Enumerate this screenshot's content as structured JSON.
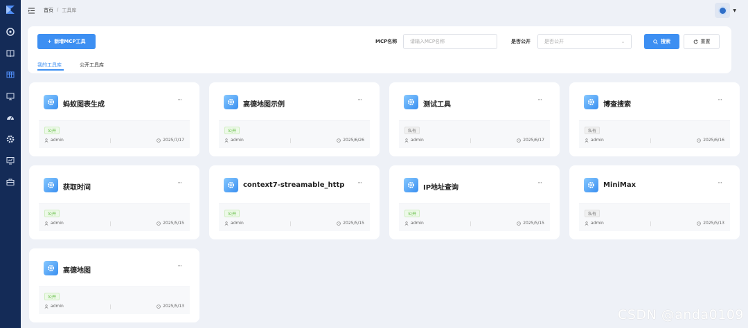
{
  "breadcrumb": {
    "home": "首页",
    "separator": "/",
    "current": "工具库"
  },
  "toolbar": {
    "new_button": "新增MCP工具",
    "name_label": "MCP名称",
    "name_placeholder": "请输入MCP名称",
    "public_label": "是否公开",
    "public_placeholder": "是否公开",
    "search_button": "搜索",
    "reset_button": "重置"
  },
  "tabs": [
    {
      "label": "我的工具库",
      "active": true
    },
    {
      "label": "公开工具库",
      "active": false
    }
  ],
  "cards": [
    {
      "title": "蚂蚁图表生成",
      "visibility": "公开",
      "owner": "admin",
      "date": "2025/7/17"
    },
    {
      "title": "高德地图示例",
      "visibility": "公开",
      "owner": "admin",
      "date": "2025/6/26"
    },
    {
      "title": "测试工具",
      "visibility": "私有",
      "owner": "admin",
      "date": "2025/6/17"
    },
    {
      "title": "博查搜索",
      "visibility": "私有",
      "owner": "admin",
      "date": "2025/6/16"
    },
    {
      "title": "获取时间",
      "visibility": "公开",
      "owner": "admin",
      "date": "2025/5/15"
    },
    {
      "title": "context7-streamable_http",
      "visibility": "公开",
      "owner": "admin",
      "date": "2025/5/15"
    },
    {
      "title": "IP地址查询",
      "visibility": "公开",
      "owner": "admin",
      "date": "2025/5/15"
    },
    {
      "title": "MiniMax",
      "visibility": "私有",
      "owner": "admin",
      "date": "2025/5/13"
    },
    {
      "title": "高德地图",
      "visibility": "公开",
      "owner": "admin",
      "date": "2025/5/13"
    }
  ],
  "more_glyph": "···",
  "watermark": "CSDN @anda0109",
  "colors": {
    "sidebar": "#142b57",
    "primary": "#3d8ff2",
    "public_badge": "#52b52f"
  }
}
